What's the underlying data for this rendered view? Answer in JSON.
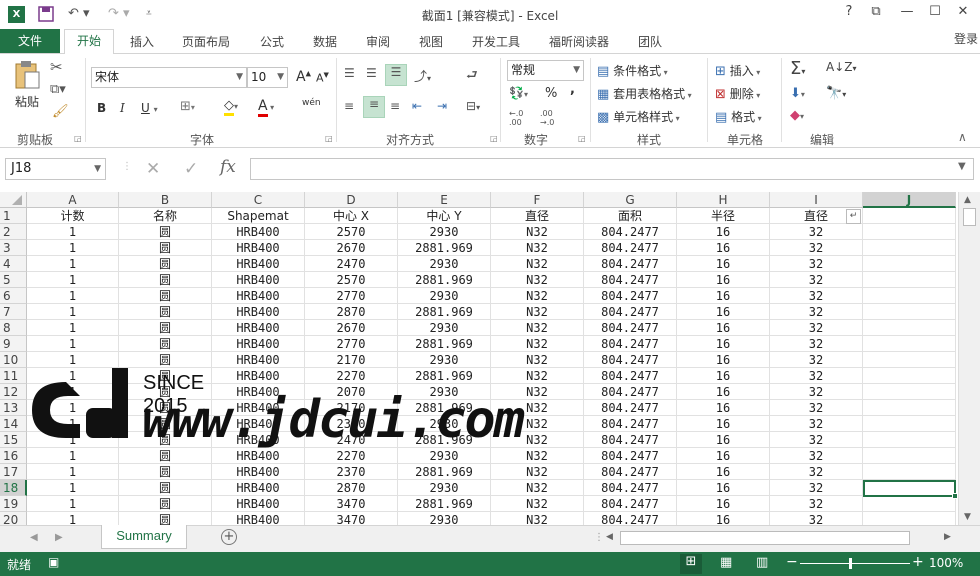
{
  "window": {
    "title": "截面1  [兼容模式] - Excel",
    "help": "?",
    "ribbon_toggle": "⧉",
    "minimize": "—",
    "maximize": "☐",
    "close": "✕"
  },
  "tabs": {
    "file": "文件",
    "items": [
      "开始",
      "插入",
      "页面布局",
      "公式",
      "数据",
      "审阅",
      "视图",
      "开发工具",
      "福昕阅读器",
      "团队"
    ],
    "login": "登录"
  },
  "ribbon": {
    "clipboard": {
      "label": "剪贴板",
      "paste": "粘贴"
    },
    "font": {
      "label": "字体",
      "name": "宋体",
      "size": "10",
      "bold": "B",
      "italic": "I",
      "underline": "U",
      "grow": "A",
      "shrink": "A",
      "color": "A",
      "phonetic": "wén"
    },
    "alignment": {
      "label": "对齐方式"
    },
    "number": {
      "label": "数字",
      "format": "常规",
      "percent": "%",
      "comma": ","
    },
    "styles": {
      "label": "样式",
      "conditional": "条件格式",
      "table": "套用表格格式",
      "cell": "单元格样式"
    },
    "cells": {
      "label": "单元格",
      "insert": "插入",
      "delete": "删除",
      "format": "格式"
    },
    "editing": {
      "label": "编辑"
    }
  },
  "formula_bar": {
    "name_box": "J18",
    "fx": "fx",
    "value": ""
  },
  "columns": [
    "A",
    "B",
    "C",
    "D",
    "E",
    "F",
    "G",
    "H",
    "I",
    "J"
  ],
  "row_numbers": [
    "1",
    "2",
    "3",
    "4",
    "5",
    "6",
    "7",
    "8",
    "9",
    "10",
    "11",
    "12",
    "13",
    "14",
    "15",
    "16",
    "17",
    "18",
    "19",
    "20"
  ],
  "rows": [
    [
      "计数",
      "名称",
      "Shapemat",
      "中心 X",
      "中心 Y",
      "直径",
      "面积",
      "半径",
      "直径",
      ""
    ],
    [
      "1",
      "圆",
      "HRB400",
      "2570",
      "2930",
      "N32",
      "804.2477",
      "16",
      "32",
      ""
    ],
    [
      "1",
      "圆",
      "HRB400",
      "2670",
      "2881.969",
      "N32",
      "804.2477",
      "16",
      "32",
      ""
    ],
    [
      "1",
      "圆",
      "HRB400",
      "2470",
      "2930",
      "N32",
      "804.2477",
      "16",
      "32",
      ""
    ],
    [
      "1",
      "圆",
      "HRB400",
      "2570",
      "2881.969",
      "N32",
      "804.2477",
      "16",
      "32",
      ""
    ],
    [
      "1",
      "圆",
      "HRB400",
      "2770",
      "2930",
      "N32",
      "804.2477",
      "16",
      "32",
      ""
    ],
    [
      "1",
      "圆",
      "HRB400",
      "2870",
      "2881.969",
      "N32",
      "804.2477",
      "16",
      "32",
      ""
    ],
    [
      "1",
      "圆",
      "HRB400",
      "2670",
      "2930",
      "N32",
      "804.2477",
      "16",
      "32",
      ""
    ],
    [
      "1",
      "圆",
      "HRB400",
      "2770",
      "2881.969",
      "N32",
      "804.2477",
      "16",
      "32",
      ""
    ],
    [
      "1",
      "圆",
      "HRB400",
      "2170",
      "2930",
      "N32",
      "804.2477",
      "16",
      "32",
      ""
    ],
    [
      "1",
      "圆",
      "HRB400",
      "2270",
      "2881.969",
      "N32",
      "804.2477",
      "16",
      "32",
      ""
    ],
    [
      "1",
      "圆",
      "HRB400",
      "2070",
      "2930",
      "N32",
      "804.2477",
      "16",
      "32",
      ""
    ],
    [
      "1",
      "圆",
      "HRB400",
      "2170",
      "2881.969",
      "N32",
      "804.2477",
      "16",
      "32",
      ""
    ],
    [
      "1",
      "圆",
      "HRB400",
      "2370",
      "2930",
      "N32",
      "804.2477",
      "16",
      "32",
      ""
    ],
    [
      "1",
      "圆",
      "HRB400",
      "2470",
      "2881.969",
      "N32",
      "804.2477",
      "16",
      "32",
      ""
    ],
    [
      "1",
      "圆",
      "HRB400",
      "2270",
      "2930",
      "N32",
      "804.2477",
      "16",
      "32",
      ""
    ],
    [
      "1",
      "圆",
      "HRB400",
      "2370",
      "2881.969",
      "N32",
      "804.2477",
      "16",
      "32",
      ""
    ],
    [
      "1",
      "圆",
      "HRB400",
      "2870",
      "2930",
      "N32",
      "804.2477",
      "16",
      "32",
      ""
    ],
    [
      "1",
      "圆",
      "HRB400",
      "3470",
      "2881.969",
      "N32",
      "804.2477",
      "16",
      "32",
      ""
    ],
    [
      "1",
      "圆",
      "HRB400",
      "3470",
      "2930",
      "N32",
      "804.2477",
      "16",
      "32",
      ""
    ]
  ],
  "active_cell": "J18",
  "sheet_tabs": [
    "Summary"
  ],
  "status": {
    "ready": "就绪",
    "zoom": "100%"
  },
  "watermark": {
    "since": "SINCE 2015",
    "url": "www.jdcui.com"
  },
  "colors": {
    "accent": "#217346",
    "selection_bg": "#c6e3d1"
  }
}
